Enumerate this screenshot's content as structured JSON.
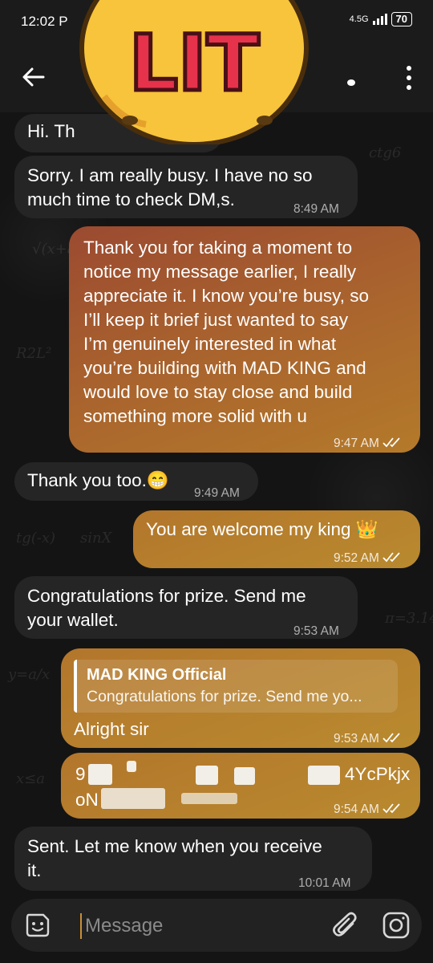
{
  "status_bar": {
    "time": "12:02 P",
    "network": "4.5G",
    "battery": "70"
  },
  "header": {
    "back_icon": "arrow-left-icon",
    "menu_icon": "more-vertical-icon"
  },
  "sticker": {
    "text": "LIT",
    "icon": "lit-emoji-sticker"
  },
  "messages": [
    {
      "direction": "in",
      "text": "Hi. Th"
    },
    {
      "direction": "in",
      "text": "Sorry. I am really busy. I have no so\nmuch time to check DM,s.",
      "time": "8:49 AM"
    },
    {
      "direction": "out",
      "text": "Thank you for taking a moment to\nnotice my message earlier, I really\nappreciate it. I know you’re busy, so\nI’ll keep it brief just wanted to say\nI’m genuinely interested in what\nyou’re building with MAD KING and\nwould love to stay close and build\nsomething more solid with u",
      "time": "9:47 AM"
    },
    {
      "direction": "in",
      "text": "Thank you too.😁",
      "time": "9:49 AM"
    },
    {
      "direction": "out",
      "text": "You are welcome my king 👑",
      "time": "9:52 AM"
    },
    {
      "direction": "in",
      "text": "Congratulations for prize. Send me\nyour wallet.",
      "time": "9:53 AM"
    },
    {
      "direction": "out",
      "reply_name": "MAD KING Official",
      "reply_text": "Congratulations for prize. Send me yo...",
      "text": "Alright sir",
      "time": "9:53 AM"
    },
    {
      "direction": "out",
      "text_line1_start": "9",
      "text_line1_end": "4YcPkjx",
      "text_line2_start": "oN",
      "time": "9:54 AM"
    },
    {
      "direction": "in",
      "text": "Sent. Let me know when you receive\nit.",
      "time": "10:01 AM"
    }
  ],
  "input": {
    "placeholder": "Message",
    "emoji_icon": "emoji-sticker-icon",
    "attach_icon": "paperclip-icon",
    "camera_icon": "camera-icon"
  }
}
